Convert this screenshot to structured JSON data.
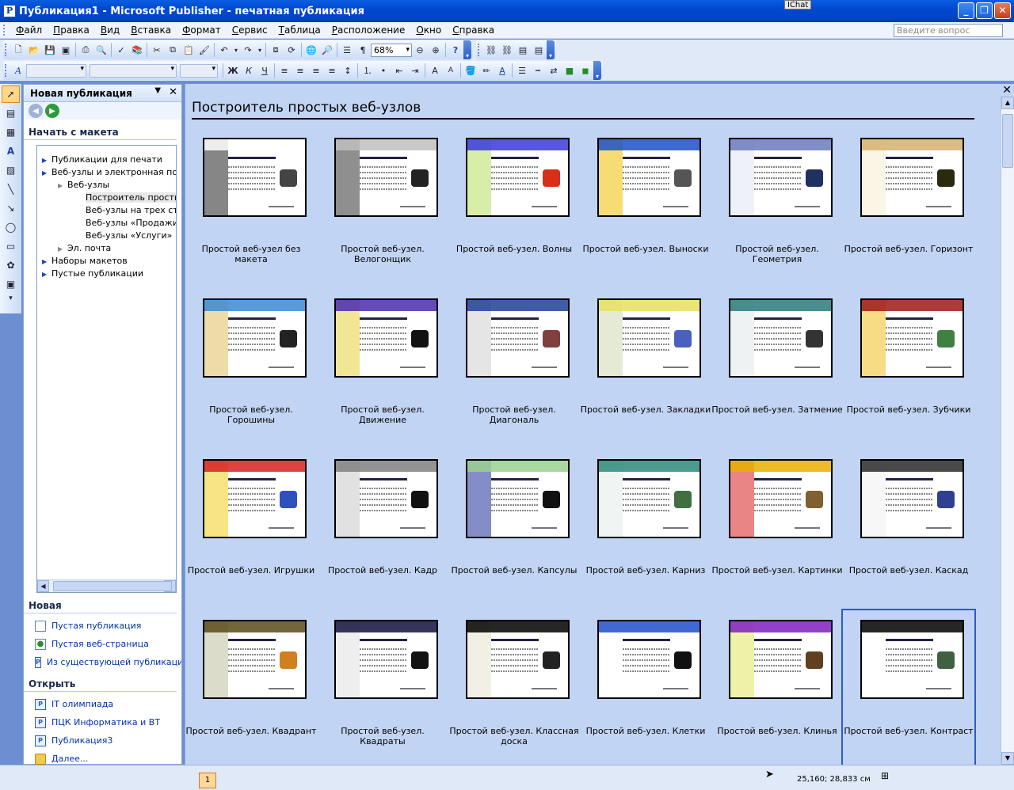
{
  "window": {
    "title": "Публикация1 - Microsoft Publisher - печатная публикация",
    "app_icon_letter": "P",
    "ichat": "IChat",
    "minimize": "_",
    "maximize": "❐",
    "close": "✕"
  },
  "menu": {
    "items": [
      "Файл",
      "Правка",
      "Вид",
      "Вставка",
      "Формат",
      "Сервис",
      "Таблица",
      "Расположение",
      "Окно",
      "Справка"
    ],
    "ask_placeholder": "Введите вопрос"
  },
  "toolbar": {
    "zoom": "68%"
  },
  "task_pane": {
    "title": "Новая публикация",
    "dropdown": "▼",
    "close": "✕",
    "start_from_template": "Начать с макета",
    "tree": [
      {
        "label": "Публикации для печати",
        "level": 0,
        "arrow": "▶"
      },
      {
        "label": "Веб-узлы и электронная почта",
        "level": 0,
        "arrow": "▶"
      },
      {
        "label": "Веб-узлы",
        "level": 1,
        "arrow": "▶"
      },
      {
        "label": "Построитель простых",
        "level": 2,
        "arrow": "",
        "selected": true
      },
      {
        "label": "Веб-узлы на трех стра",
        "level": 2,
        "arrow": ""
      },
      {
        "label": "Веб-узлы «Продажи»",
        "level": 2,
        "arrow": ""
      },
      {
        "label": "Веб-узлы «Услуги»",
        "level": 2,
        "arrow": ""
      },
      {
        "label": "Эл. почта",
        "level": 1,
        "arrow": "▶"
      },
      {
        "label": "Наборы макетов",
        "level": 0,
        "arrow": "▶"
      },
      {
        "label": "Пустые публикации",
        "level": 0,
        "arrow": "▶"
      }
    ],
    "new_section": "Новая",
    "new_items": [
      {
        "label": "Пустая публикация",
        "icon": "document-icon"
      },
      {
        "label": "Пустая веб-страница",
        "icon": "web-page-icon"
      },
      {
        "label": "Из существующей публикации...",
        "icon": "publication-icon"
      }
    ],
    "open_section": "Открыть",
    "open_items": [
      {
        "label": "IT олимпиада",
        "icon": "publication-icon"
      },
      {
        "label": "ПЦК Информатика и ВТ",
        "icon": "publication-icon"
      },
      {
        "label": "Публикация3",
        "icon": "publication-icon"
      },
      {
        "label": "Далее...",
        "icon": "folder-icon"
      }
    ]
  },
  "gallery": {
    "title": "Построитель простых веб-узлов",
    "close": "✕",
    "items": [
      {
        "label": "Простой веб-узел без макета",
        "accent": "#ffffff",
        "accent2": "#222222",
        "pic": "#444444"
      },
      {
        "label": "Простой веб-узел. Велогонщик",
        "accent": "#c0c0c0",
        "accent2": "#333333",
        "pic": "#222222"
      },
      {
        "label": "Простой веб-узел. Волны",
        "accent": "#3a3ad8",
        "accent2": "#b8e060",
        "pic": "#d83018"
      },
      {
        "label": "Простой веб-узел. Выноски",
        "accent": "#1f4fc8",
        "accent2": "#f0c000",
        "pic": "#555555"
      },
      {
        "label": "Простой веб-узел. Геометрия",
        "accent": "#6a7ac0",
        "accent2": "#e0e6f0",
        "pic": "#203060"
      },
      {
        "label": "Простой веб-узел. Горизонт",
        "accent": "#d4b070",
        "accent2": "#f5ecd0",
        "pic": "#2a2a10"
      },
      {
        "label": "Простой веб-узел. Горошины",
        "accent": "#3a8ad8",
        "accent2": "#e0c060",
        "pic": "#222222"
      },
      {
        "label": "Простой веб-узел. Движение",
        "accent": "#4a2ab0",
        "accent2": "#e8d040",
        "pic": "#111111"
      },
      {
        "label": "Простой веб-узел. Диагональ",
        "accent": "#1f3f9a",
        "accent2": "#d0d0d0",
        "pic": "#804040"
      },
      {
        "label": "Простой веб-узел. Закладки",
        "accent": "#e8e060",
        "accent2": "#d0d8b0",
        "pic": "#4a60c0"
      },
      {
        "label": "Простой веб-узел. Затмение",
        "accent": "#2a7a7a",
        "accent2": "#e0e8e8",
        "pic": "#333333"
      },
      {
        "label": "Простой веб-узел. Зубчики",
        "accent": "#a01818",
        "accent2": "#f0c020",
        "pic": "#408040"
      },
      {
        "label": "Простой веб-узел. Игрушки",
        "accent": "#d82020",
        "accent2": "#f0d020",
        "pic": "#3050c0"
      },
      {
        "label": "Простой веб-узел. Кадр",
        "accent": "#808080",
        "accent2": "#c8c8c8",
        "pic": "#111111"
      },
      {
        "label": "Простой веб-узел. Капсулы",
        "accent": "#9ad090",
        "accent2": "#1f2f9a",
        "pic": "#111111"
      },
      {
        "label": "Простой веб-узел. Карниз",
        "accent": "#2a8a7a",
        "accent2": "#e0ece8",
        "pic": "#407040"
      },
      {
        "label": "Простой веб-узел. Картинки",
        "accent": "#e8b000",
        "accent2": "#d82020",
        "pic": "#806030"
      },
      {
        "label": "Простой веб-узел. Каскад",
        "accent": "#2a2a2a",
        "accent2": "#f0f0f0",
        "pic": "#304090"
      },
      {
        "label": "Простой веб-узел. Квадрант",
        "accent": "#5a4a1a",
        "accent2": "#c0c0a0",
        "pic": "#d08020"
      },
      {
        "label": "Простой веб-узел. Квадраты",
        "accent": "#101040",
        "accent2": "#e0e0e0",
        "pic": "#111111"
      },
      {
        "label": "Простой веб-узел. Классная доска",
        "accent": "#000000",
        "accent2": "#e8e4d0",
        "pic": "#222222"
      },
      {
        "label": "Простой веб-узел. Клетки",
        "accent": "#1f4fc8",
        "accent2": "#ffffff",
        "pic": "#111111"
      },
      {
        "label": "Простой веб-узел. Клинья",
        "accent": "#8020c0",
        "accent2": "#e0e860",
        "pic": "#604020"
      },
      {
        "label": "Простой веб-узел. Контраст",
        "accent": "#000000",
        "accent2": "#ffffff",
        "pic": "#406040"
      }
    ]
  },
  "status": {
    "page": "1",
    "coords": "25,160; 28,833 см"
  }
}
